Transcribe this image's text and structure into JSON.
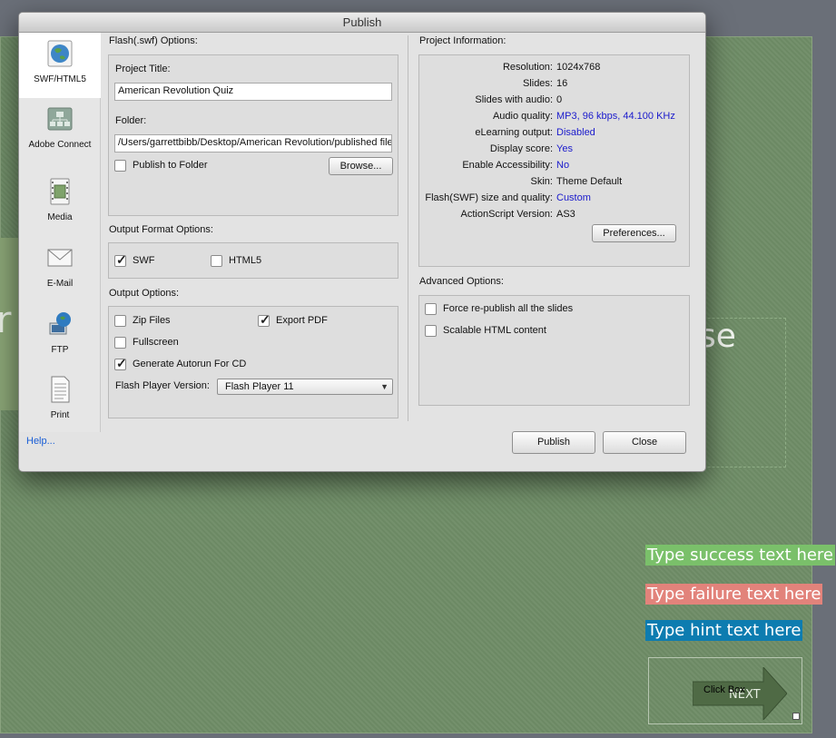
{
  "dialog": {
    "title": "Publish"
  },
  "sidebar": {
    "items": [
      {
        "label": "SWF/HTML5",
        "icon": "globe-icon",
        "active": true
      },
      {
        "label": "Adobe Connect",
        "icon": "network-icon",
        "active": false
      },
      {
        "label": "Media",
        "icon": "film-icon",
        "active": false
      },
      {
        "label": "E-Mail",
        "icon": "envelope-icon",
        "active": false
      },
      {
        "label": "FTP",
        "icon": "ftp-globe-icon",
        "active": false
      },
      {
        "label": "Print",
        "icon": "document-icon",
        "active": false
      }
    ]
  },
  "flash_options": {
    "section_title": "Flash(.swf) Options:",
    "project_title_label": "Project Title:",
    "project_title_value": "American Revolution Quiz",
    "folder_label": "Folder:",
    "folder_value": "/Users/garrettbibb/Desktop/American Revolution/published file",
    "publish_to_folder_label": "Publish to Folder",
    "publish_to_folder_checked": false,
    "browse_label": "Browse..."
  },
  "output_format": {
    "section_title": "Output Format Options:",
    "swf_label": "SWF",
    "swf_checked": true,
    "html5_label": "HTML5",
    "html5_checked": false
  },
  "output_options": {
    "section_title": "Output Options:",
    "zip_files_label": "Zip Files",
    "zip_files_checked": false,
    "export_pdf_label": "Export PDF",
    "export_pdf_checked": true,
    "fullscreen_label": "Fullscreen",
    "fullscreen_checked": false,
    "autorun_label": "Generate Autorun For CD",
    "autorun_checked": true,
    "player_version_label": "Flash Player Version:",
    "player_version_value": "Flash Player 11"
  },
  "project_info": {
    "section_title": "Project Information:",
    "rows": [
      {
        "key": "Resolution:",
        "value": "1024x768",
        "link": false
      },
      {
        "key": "Slides:",
        "value": "16",
        "link": false
      },
      {
        "key": "Slides with audio:",
        "value": "0",
        "link": false
      },
      {
        "key": "Audio quality:",
        "value": "MP3, 96 kbps, 44.100 KHz",
        "link": true
      },
      {
        "key": "eLearning output:",
        "value": "Disabled",
        "link": true
      },
      {
        "key": "Display score:",
        "value": "Yes",
        "link": true
      },
      {
        "key": "Enable Accessibility:",
        "value": "No",
        "link": true
      },
      {
        "key": "Skin:",
        "value": "Theme Default",
        "link": false
      },
      {
        "key": "Flash(SWF) size and quality:",
        "value": "Custom",
        "link": true
      },
      {
        "key": "ActionScript Version:",
        "value": "AS3",
        "link": false
      }
    ],
    "preferences_label": "Preferences..."
  },
  "advanced": {
    "section_title": "Advanced Options:",
    "republish_label": "Force re-publish all the slides",
    "republish_checked": false,
    "scalable_label": "Scalable HTML content",
    "scalable_checked": false
  },
  "footer": {
    "help_label": "Help...",
    "publish_label": "Publish",
    "close_label": "Close"
  },
  "slide": {
    "left_letter": "r",
    "right_text": "se",
    "success_caption": "Type success text here",
    "failure_caption": "Type failure text here",
    "hint_caption": "Type hint text here",
    "click_box_label": "Click Box",
    "next_label": "NEXT"
  },
  "colors": {
    "slide_bg": "#6f8d67",
    "success": "#7ac06a",
    "failure": "#e2837b",
    "hint": "#0d7cb0",
    "link": "#1a1acc"
  }
}
